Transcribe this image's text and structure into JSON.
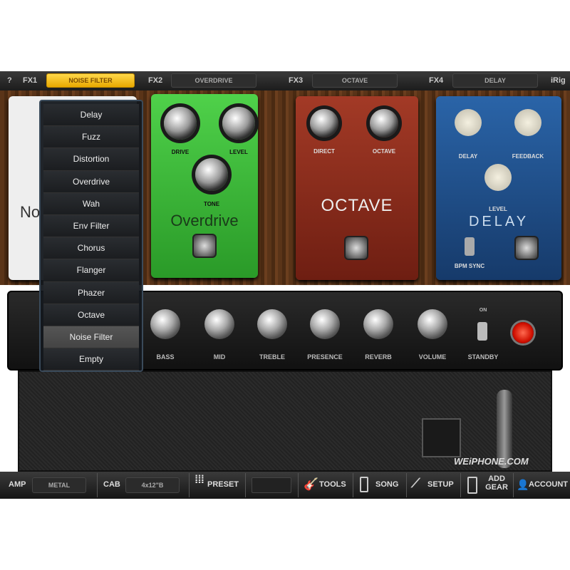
{
  "topbar": {
    "help": "?",
    "slots": [
      {
        "label": "FX1",
        "value": "NOISE FILTER",
        "selected": true
      },
      {
        "label": "FX2",
        "value": "OVERDRIVE"
      },
      {
        "label": "FX3",
        "value": "OCTAVE"
      },
      {
        "label": "FX4",
        "value": "DELAY"
      }
    ],
    "brand": "iRig"
  },
  "pedals": {
    "noise": {
      "name": "No"
    },
    "overdrive": {
      "name": "Overdrive",
      "knobs": [
        "DRIVE",
        "LEVEL",
        "TONE"
      ],
      "color": "#3cb83a"
    },
    "octave": {
      "name": "OCTAVE",
      "knobs": [
        "DIRECT",
        "OCTAVE"
      ],
      "color": "#8c2a1c"
    },
    "delay": {
      "name": "DELAY",
      "knobs": [
        "DELAY",
        "FEEDBACK",
        "LEVEL"
      ],
      "switch": "BPM SYNC",
      "color": "#1e4f8a"
    }
  },
  "menu": {
    "items": [
      "Delay",
      "Fuzz",
      "Distortion",
      "Overdrive",
      "Wah",
      "Env Filter",
      "Chorus",
      "Flanger",
      "Phazer",
      "Octave",
      "Noise Filter",
      "Empty"
    ],
    "selected": "Noise Filter"
  },
  "amp": {
    "knobs": [
      "BASS",
      "MID",
      "TREBLE",
      "PRESENCE",
      "REVERB",
      "VOLUME"
    ],
    "standby_label": "STANDBY",
    "on_label": "ON"
  },
  "watermark": "WEiPHONE.COM",
  "bottombar": {
    "amp_label": "AMP",
    "amp_value": "METAL",
    "cab_label": "CAB",
    "cab_value": "4x12\"B",
    "preset": "PRESET",
    "tools": "TOOLS",
    "song": "SONG",
    "setup": "SETUP",
    "add_gear": "ADD GEAR",
    "account": "ACCOUNT"
  }
}
